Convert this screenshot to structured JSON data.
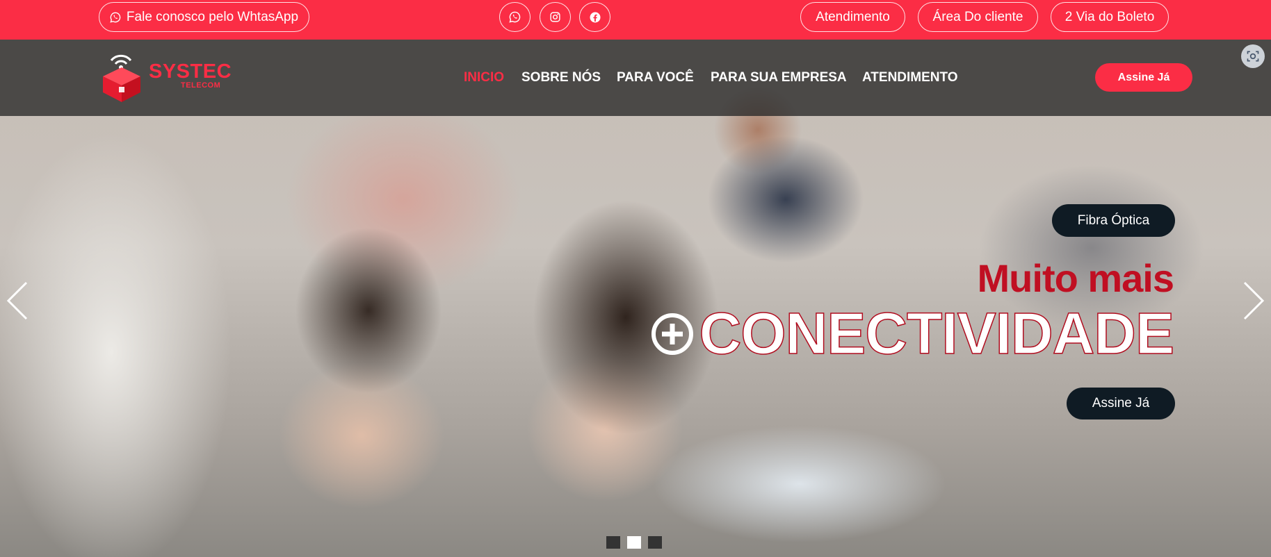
{
  "topbar": {
    "whatsapp_label": "Fale conosco pelo WhtasApp",
    "social_icons": [
      "whatsapp-icon",
      "instagram-icon",
      "facebook-icon"
    ],
    "links": [
      "Atendimento",
      "Área Do cliente",
      "2 Via do Boleto"
    ]
  },
  "brand": {
    "name": "SYSTEC",
    "tagline": "TELECOM",
    "color": "#fb2d45"
  },
  "nav": {
    "items": [
      "INICIO",
      "SOBRE NÓS",
      "PARA VOCÊ",
      "PARA SUA EMPRESA",
      "ATENDIMENTO"
    ],
    "active_index": 0,
    "cta": "Assine Já"
  },
  "hero": {
    "badge": "Fibra Óptica",
    "headline_top": "Muito mais",
    "headline_bottom": "CONECTIVIDADE",
    "plus_symbol": "+",
    "cta": "Assine Já"
  },
  "slider": {
    "slide_count": 3,
    "active_slide": 2
  },
  "colors": {
    "accent": "#fb2d45",
    "headline_red": "#c00f22",
    "dark_button": "#0f1b24"
  }
}
